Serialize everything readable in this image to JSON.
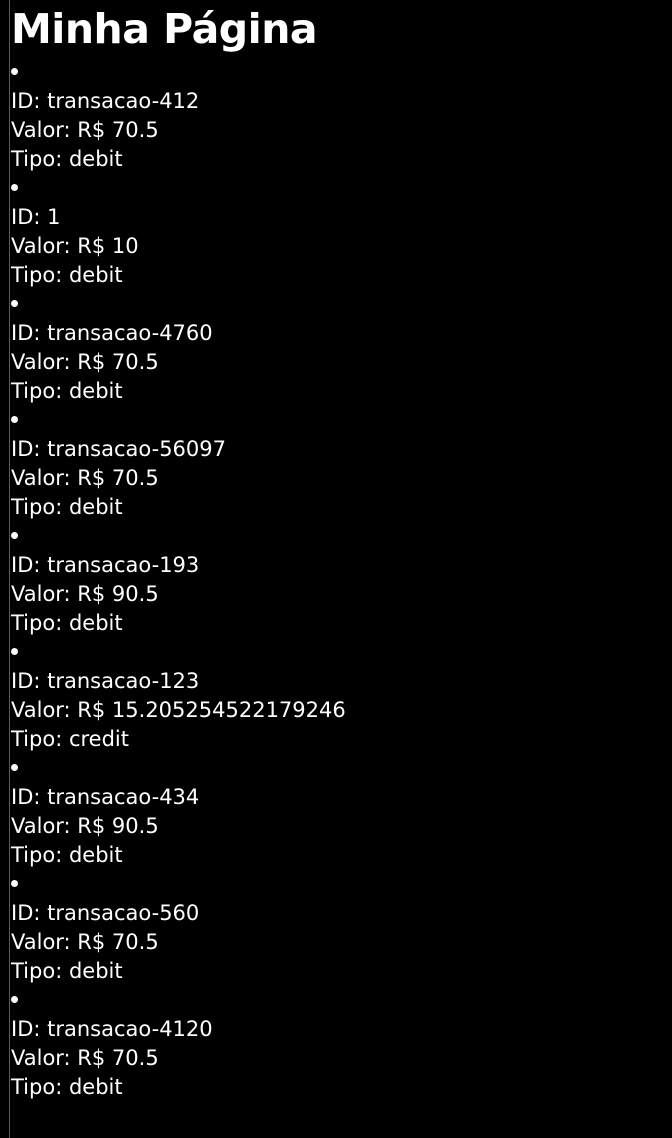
{
  "page": {
    "title": "Minha Página"
  },
  "transactions": [
    {
      "id_label": "ID: transacao-412",
      "valor_label": "Valor: R$ 70.5",
      "tipo_label": "Tipo: debit"
    },
    {
      "id_label": "ID: 1",
      "valor_label": "Valor: R$ 10",
      "tipo_label": "Tipo: debit"
    },
    {
      "id_label": "ID: transacao-4760",
      "valor_label": "Valor: R$ 70.5",
      "tipo_label": "Tipo: debit"
    },
    {
      "id_label": "ID: transacao-56097",
      "valor_label": "Valor: R$ 70.5",
      "tipo_label": "Tipo: debit"
    },
    {
      "id_label": "ID: transacao-193",
      "valor_label": "Valor: R$ 90.5",
      "tipo_label": "Tipo: debit"
    },
    {
      "id_label": "ID: transacao-123",
      "valor_label": "Valor: R$ 15.205254522179246",
      "tipo_label": "Tipo: credit"
    },
    {
      "id_label": "ID: transacao-434",
      "valor_label": "Valor: R$ 90.5",
      "tipo_label": "Tipo: debit"
    },
    {
      "id_label": "ID: transacao-560",
      "valor_label": "Valor: R$ 70.5",
      "tipo_label": "Tipo: debit"
    },
    {
      "id_label": "ID: transacao-4120",
      "valor_label": "Valor: R$ 70.5",
      "tipo_label": "Tipo: debit"
    }
  ]
}
